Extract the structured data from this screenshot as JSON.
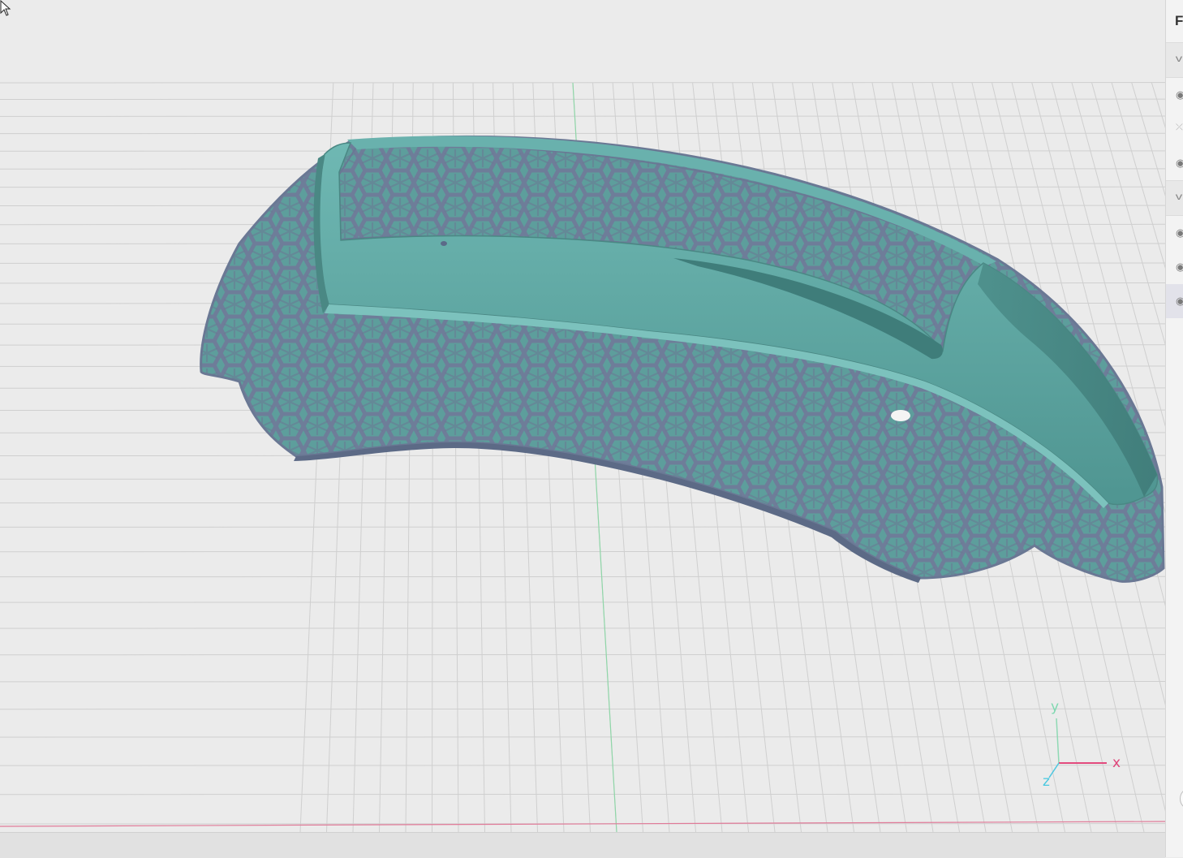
{
  "panel": {
    "title": "F",
    "sections": [
      {
        "chevron_icon": "chevron-down-icon",
        "glyph": "v"
      },
      {
        "chevron_icon": "chevron-down-icon",
        "glyph": "v"
      }
    ],
    "rows": [
      {
        "icon": "eye-icon",
        "glyph": "◉",
        "visible": true
      },
      {
        "icon": "eye-off-icon",
        "glyph": "⤫",
        "visible": false
      },
      {
        "icon": "eye-icon",
        "glyph": "◉",
        "visible": true
      },
      {
        "icon": "eye-icon",
        "glyph": "◉",
        "visible": true
      },
      {
        "icon": "eye-icon",
        "glyph": "◉",
        "visible": true
      },
      {
        "icon": "eye-icon",
        "glyph": "◉",
        "visible": true,
        "selected": true
      }
    ]
  },
  "axes": {
    "x_label": "x",
    "y_label": "y",
    "z_label": "z"
  },
  "colors": {
    "background": "#ebebeb",
    "grid": "#cfcfcf",
    "model_solid": "#5aa4a0",
    "model_lattice": "#6b7a96",
    "x_axis": "#e0457a",
    "y_axis": "#7fd8b0",
    "z_axis": "#48c8e0"
  }
}
